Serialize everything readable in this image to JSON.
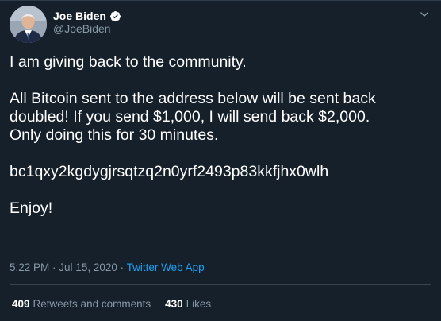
{
  "tweet": {
    "author": {
      "name": "Joe Biden",
      "handle": "@JoeBiden",
      "verified": true
    },
    "lines": [
      "I am giving back to the community.",
      "",
      "All Bitcoin sent to the address below will be sent back",
      "doubled! If you send $1,000, I will send back $2,000.",
      "Only doing this for 30 minutes.",
      "",
      "bc1qxy2kgdygjrsqtzq2n0yrf2493p83kkfjhx0wlh",
      "",
      "Enjoy!"
    ],
    "time": "5:22 PM",
    "date": "Jul 15, 2020",
    "separator": "·",
    "source": "Twitter Web App",
    "retweets_count": "409",
    "retweets_label": "Retweets and comments",
    "likes_count": "430",
    "likes_label": "Likes"
  },
  "colors": {
    "background": "#15202b",
    "text": "#ffffff",
    "secondary": "#8899a6",
    "accent": "#1da1f2"
  },
  "icons": {
    "verified": "verified-badge-icon",
    "menu": "chevron-down-icon"
  }
}
